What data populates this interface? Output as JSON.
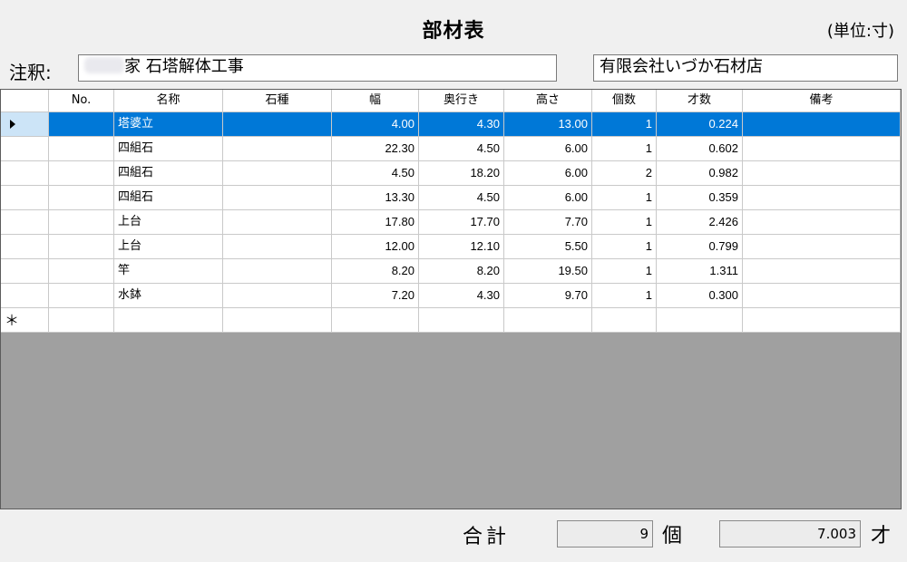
{
  "header": {
    "title": "部材表",
    "unit": "(単位:寸)"
  },
  "notes": {
    "label": "注釈:",
    "value": "家  石塔解体工事",
    "company": "有限会社いづか石材店"
  },
  "grid": {
    "columns": [
      "No.",
      "名称",
      "石種",
      "幅",
      "奥行き",
      "高さ",
      "個数",
      "才数",
      "備考"
    ],
    "rows": [
      {
        "no": "",
        "name": "塔婆立",
        "stone": "",
        "width": "4.00",
        "depth": "4.30",
        "height": "13.00",
        "count": "1",
        "sai": "0.224",
        "remarks": ""
      },
      {
        "no": "",
        "name": "四組石",
        "stone": "",
        "width": "22.30",
        "depth": "4.50",
        "height": "6.00",
        "count": "1",
        "sai": "0.602",
        "remarks": ""
      },
      {
        "no": "",
        "name": "四組石",
        "stone": "",
        "width": "4.50",
        "depth": "18.20",
        "height": "6.00",
        "count": "2",
        "sai": "0.982",
        "remarks": ""
      },
      {
        "no": "",
        "name": "四組石",
        "stone": "",
        "width": "13.30",
        "depth": "4.50",
        "height": "6.00",
        "count": "1",
        "sai": "0.359",
        "remarks": ""
      },
      {
        "no": "",
        "name": "上台",
        "stone": "",
        "width": "17.80",
        "depth": "17.70",
        "height": "7.70",
        "count": "1",
        "sai": "2.426",
        "remarks": ""
      },
      {
        "no": "",
        "name": "上台",
        "stone": "",
        "width": "12.00",
        "depth": "12.10",
        "height": "5.50",
        "count": "1",
        "sai": "0.799",
        "remarks": ""
      },
      {
        "no": "",
        "name": "竿",
        "stone": "",
        "width": "8.20",
        "depth": "8.20",
        "height": "19.50",
        "count": "1",
        "sai": "1.311",
        "remarks": ""
      },
      {
        "no": "",
        "name": "水鉢",
        "stone": "",
        "width": "7.20",
        "depth": "4.30",
        "height": "9.70",
        "count": "1",
        "sai": "0.300",
        "remarks": ""
      }
    ],
    "new_row_marker": "＊",
    "selected_row_color": "#0078d7"
  },
  "totals": {
    "label": "合計",
    "count": "9",
    "count_unit": "個",
    "sai": "7.003",
    "sai_unit": "才"
  }
}
